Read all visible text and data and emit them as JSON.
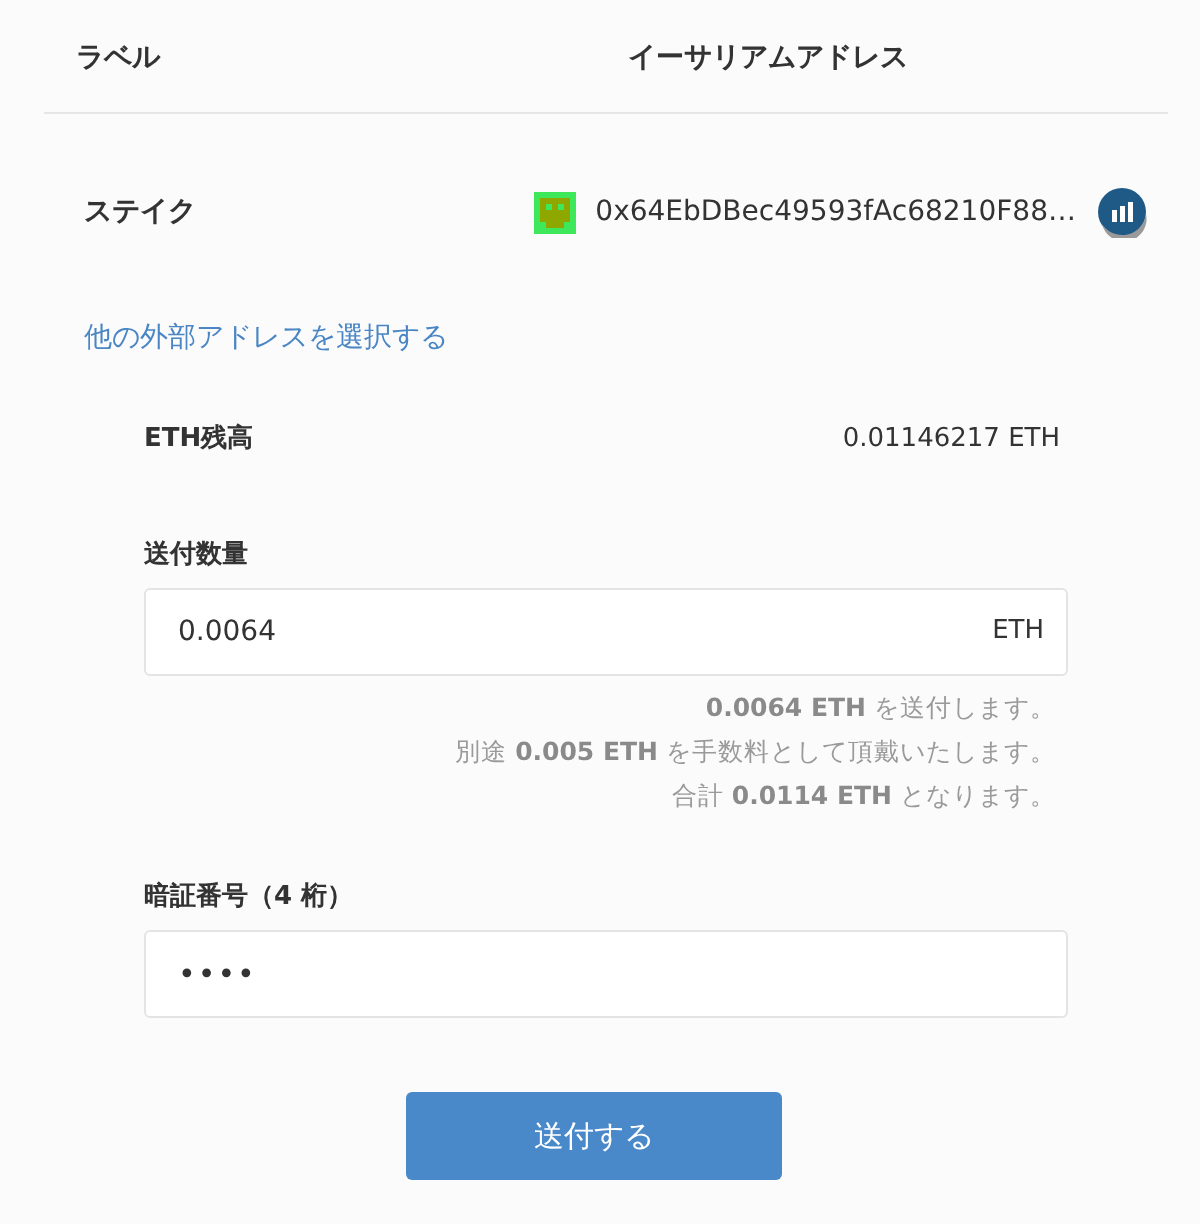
{
  "table": {
    "columns": [
      "ラベル",
      "イーサリアムアドレス"
    ],
    "rows": [
      {
        "label": "ステイク",
        "address": "0x64EbDBec49593fAc68210F88…"
      }
    ]
  },
  "other_address_link": "他の外部アドレスを選択する",
  "balance": {
    "label": "ETH残高",
    "value": "0.01146217 ETH"
  },
  "amount": {
    "label": "送付数量",
    "value": "0.0064",
    "unit": "ETH"
  },
  "notes": [
    "**0.0064 ETH** を送付します。",
    "別途 **0.005 ETH** を手数料として頂戴いたします。",
    "合計 **0.0114 ETH** となります。"
  ],
  "pin": {
    "label": "暗証番号（4 桁）",
    "value": "••••"
  },
  "submit": "送付する"
}
